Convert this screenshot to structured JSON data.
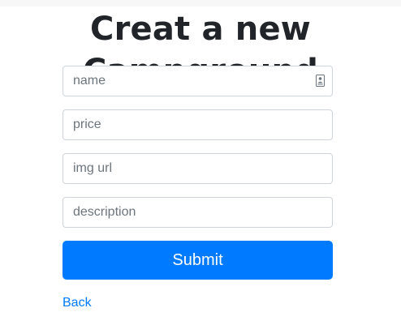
{
  "page": {
    "title": "Creat a new Campground"
  },
  "form": {
    "name_placeholder": "name",
    "price_placeholder": "price",
    "img_url_placeholder": "img url",
    "description_placeholder": "description",
    "submit_label": "Submit",
    "name_field_icon": "contact-card-icon"
  },
  "nav": {
    "back_label": "Back"
  },
  "colors": {
    "primary": "#007bff",
    "heading": "#212529",
    "input_border": "#ced4da",
    "placeholder": "#6c757d"
  }
}
